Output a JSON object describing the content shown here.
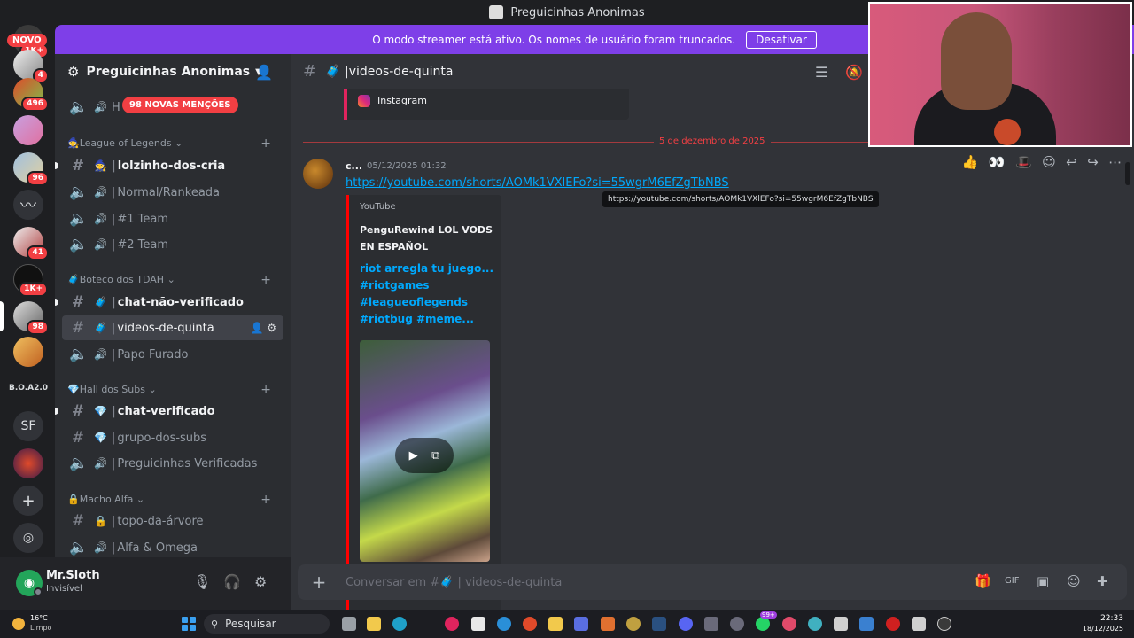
{
  "window": {
    "title": "Preguicinhas Anonimas"
  },
  "banner": {
    "text": "O modo streamer está ativo. Os nomes de usuário foram truncados.",
    "button": "Desativar"
  },
  "rail": {
    "novo": "NOVO",
    "badges": [
      "1K+",
      "4",
      "496",
      "96",
      "41",
      "1K+",
      "98"
    ],
    "boa_label": "B.O.A2.0",
    "sf_label": "SF"
  },
  "guild": {
    "name": "Preguicinhas Anonimas"
  },
  "mentions_badge": "98 NOVAS MENÇÕES",
  "sidebar": {
    "top_channel_initial": "H",
    "categories": [
      {
        "name": "League of Legends",
        "channels": [
          "lolzinho-dos-cria",
          "Normal/Rankeada",
          "#1 Team",
          "#2 Team"
        ]
      },
      {
        "name": "Boteco dos TDAH",
        "channels": [
          "chat-não-verificado",
          "videos-de-quinta",
          "Papo Furado"
        ]
      },
      {
        "name": "Hall dos Subs",
        "channels": [
          "chat-verificado",
          "grupo-dos-subs",
          "Preguicinhas Verificadas"
        ]
      },
      {
        "name": "Macho Alfa",
        "channels": [
          "topo-da-árvore",
          "Alfa & Omega"
        ]
      }
    ]
  },
  "user": {
    "name": "Mr.Sloth",
    "status": "Invisível"
  },
  "channel": {
    "name": "videos-de-quinta"
  },
  "previous_embed": {
    "label": "Instagram"
  },
  "divider": {
    "date": "5 de dezembro de 2025"
  },
  "message": {
    "author": "c...",
    "timestamp": "05/12/2025 01:32",
    "link": "https://youtube.com/shorts/AOMk1VXlEFo?si=55wgrM6EfZgTbNBS",
    "tooltip": "https://youtube.com/shorts/AOMk1VXlEFo?si=55wgrM6EfZgTbNBS",
    "embed": {
      "provider": "YouTube",
      "author": "PenguRewind LOL VODS EN ESPAÑOL",
      "title": "riot arregla tu juego... #riotgames #leagueoflegends #riotbug #meme..."
    }
  },
  "composer": {
    "placeholder": "Conversar em #🧳 | videos-de-quinta"
  },
  "taskbar": {
    "temp": "16°C",
    "condition": "Limpo",
    "search": "Pesquisar",
    "time": "22:33",
    "date": "18/12/2025",
    "whatsapp_badge": "99+"
  },
  "colors": {
    "accent": "#7e3fe8",
    "mention": "#f23f43",
    "link": "#00a8fc",
    "online": "#23a55a"
  }
}
